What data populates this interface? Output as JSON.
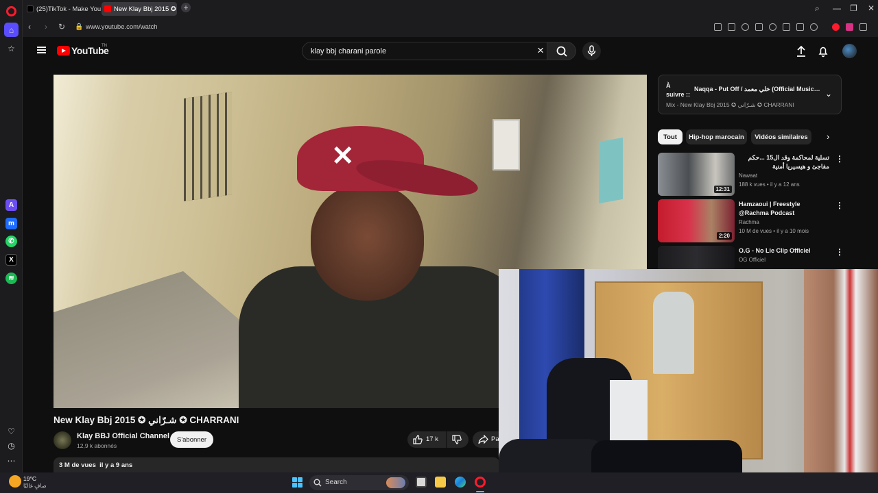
{
  "browser": {
    "tabs": [
      {
        "label": "(25)TikTok - Make Your Da"
      },
      {
        "label": "New Klay Bbj 2015 ✪ شـرّاني"
      }
    ],
    "url": "www.youtube.com/watch"
  },
  "youtube": {
    "logo_text": "YouTube",
    "country_code": "TN",
    "search_query": "klay bbj charani parole"
  },
  "video": {
    "title": "New Klay Bbj 2015 ✪ شـرّاني ✪ CHARRANI",
    "channel_name": "Klay BBJ Official Channel",
    "subscribers": "12,9 k abonnés",
    "subscribe_label": "S'abonner",
    "likes": "17 k",
    "share_label": "Pa",
    "views": "3 M de vues",
    "age": "il y a 9 ans"
  },
  "up_next": {
    "label": "À suivre ::",
    "title": "Naqqa - Put Off / خلي معمد (Official Music Vi...",
    "subtitle": "Mix - New Klay Bbj 2015 ✪ شـرّاني ✪ CHARRANI"
  },
  "chips": [
    "Tout",
    "Hip-hop marocain",
    "Vidéos similaires"
  ],
  "recommendations": [
    {
      "title": "تسلية لمحاكمة وقد ال15 ...حكم مفاجئ و هيسيريا أمنية",
      "channel": "Nawaat",
      "views": "188 k vues",
      "age": "il y a 12 ans",
      "duration": "12:31"
    },
    {
      "title": "Hamzaoui | Freestyle @Rachma Podcast",
      "channel": "Rachma",
      "views": "10 M de vues",
      "age": "il y a 10 mois",
      "duration": "2:20"
    },
    {
      "title": "O.G - No Lie Clip Officiel",
      "channel": "OG Officiel",
      "views": "",
      "age": "",
      "duration": ""
    }
  ],
  "taskbar": {
    "temperature": "19°C",
    "weather": "صافٍ غالبًا",
    "search_label": "Search"
  },
  "colors": {
    "yt_red": "#ff0000",
    "opera_red": "#ff1b2d",
    "background": "#0f0f0f"
  }
}
